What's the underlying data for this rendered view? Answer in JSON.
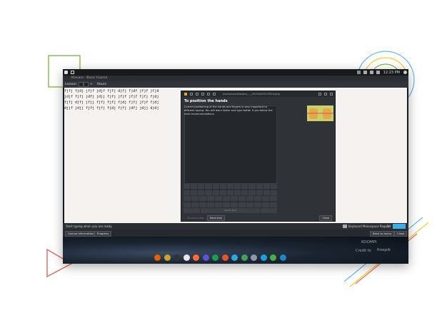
{
  "app": {
    "title": "Klavaro - Basic Course"
  },
  "topbar": {
    "clock": "12:23 PM"
  },
  "toolbar": {
    "lesson_label": "Lesson:",
    "lesson_value": "1",
    "hours_label": "Hours"
  },
  "lesson_lines": [
    "fjfj fjdj jfjf jdjf fjfj djfj fjdf jfjf jfjd",
    "jdjf fjfj jdfj jdjj fjfj jfjf jfjf fjfj fjdj",
    "fjfj djfj jfjj fjfj fjfj fjdj fjfj jfjf fjdj",
    "djjf jdjj fjfj fjfj fjdj fjfj jdfj jdjj djdj"
  ],
  "dialog": {
    "path": "/home/user/klavaro_..._20190420123924.png",
    "title": "To position the hands",
    "text": "Correct positioning of the hands and fingers is very important to efficient typing. You will learn faster and type better if you follow the next recommendations.",
    "space_label": "SPACE BAR",
    "prev_label": "Previous step",
    "next_label": "Next step",
    "close_label": "Close"
  },
  "status": {
    "text": "Start typing when you are ready.",
    "keyboard_label": "Keyboard",
    "font_label": "Monospace Regular",
    "font_size": "14"
  },
  "bottom": {
    "course_info": "Course information",
    "progress": "Progress",
    "back_label": "Back to menu",
    "close_label": "Close"
  },
  "watermarks": {
    "koompi": "KOOMPI",
    "credit": "Credit to",
    "freepik": "freepik"
  },
  "colors": {
    "accent": "#3daee9",
    "green_square": "#6ab023",
    "red_triangle": "#e74c3c"
  },
  "dock_icons": [
    {
      "name": "firefox-icon",
      "color": "#e66000"
    },
    {
      "name": "files-icon",
      "color": "#c9a227"
    },
    {
      "name": "terminal-icon",
      "color": "#333333"
    },
    {
      "name": "app-4-icon",
      "color": "#e8e8e8"
    },
    {
      "name": "app-5-icon",
      "color": "#ff6b35"
    },
    {
      "name": "app-6-icon",
      "color": "#5a55d6"
    },
    {
      "name": "spreadsheet-icon",
      "color": "#1e9e4a"
    },
    {
      "name": "presentation-icon",
      "color": "#e8542e"
    },
    {
      "name": "app-9-icon",
      "color": "#2ca9e1"
    },
    {
      "name": "app-10-icon",
      "color": "#3aa655"
    },
    {
      "name": "app-11-icon",
      "color": "#8d9aa8"
    },
    {
      "name": "app-12-icon",
      "color": "#1ba1e2"
    },
    {
      "name": "app-13-icon",
      "color": "#47b04b"
    },
    {
      "name": "app-14-icon",
      "color": "#1e88c7"
    }
  ]
}
